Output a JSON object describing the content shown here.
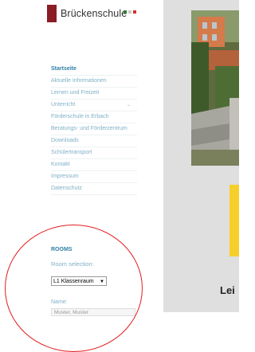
{
  "logo": {
    "text": "Brückenschule"
  },
  "colors": {
    "accent": "#2f7fa8",
    "nav_link": "#7fb0c7",
    "brand": "#8a1d25",
    "notice": "#f6cf2a",
    "annotation": "#e41d1d"
  },
  "nav": {
    "items": [
      {
        "label": "Startseite",
        "active": true
      },
      {
        "label": "Aktuelle Informationen"
      },
      {
        "label": "Lernen und Freizeit"
      },
      {
        "label": "Unterricht",
        "has_submenu": true
      },
      {
        "label": "Förderschule in Erbach"
      },
      {
        "label": "Beratungs- und Förderzentrum"
      },
      {
        "label": "Downloads"
      },
      {
        "label": "Schülertransport"
      },
      {
        "label": "Kontakt"
      },
      {
        "label": "Impressum"
      },
      {
        "label": "Datenschutz"
      }
    ]
  },
  "rooms": {
    "title": "ROOMS",
    "selection_label": "Room selection:",
    "selected_room": "L1 Klassenraum",
    "name_label": "Name:",
    "name_placeholder": "Muster, Muster"
  },
  "main": {
    "heading": "Lei"
  },
  "icons": {
    "submenu": "chevron-down-icon",
    "select": "chevron-down-icon"
  }
}
